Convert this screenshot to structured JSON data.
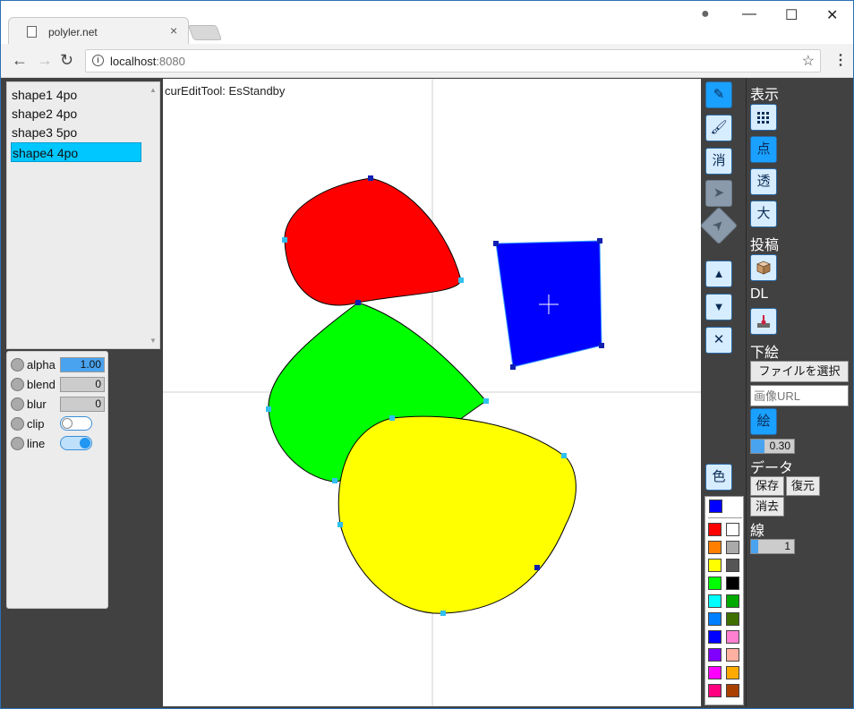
{
  "browser": {
    "tab_title": "polyler.net",
    "tab_close": "×",
    "url_host": "localhost",
    "url_port": ":8080",
    "info_glyph": "i",
    "star": "☆",
    "menu": "⋮",
    "back": "←",
    "forward": "→",
    "reload": "↻",
    "account": "●",
    "minimize": "—",
    "maximize": "☐",
    "close": "✕"
  },
  "shape_list": {
    "items": [
      "shape1 4po",
      "shape2 4po",
      "shape3 5po",
      "shape4 4po"
    ],
    "selected_index": 3,
    "scroll_up": "▲",
    "scroll_down": "▼"
  },
  "props": {
    "alpha": {
      "label": "alpha",
      "value": "1.00"
    },
    "blend": {
      "label": "blend",
      "value": "0"
    },
    "blur": {
      "label": "blur",
      "value": "0"
    },
    "clip": {
      "label": "clip",
      "on": false
    },
    "line": {
      "label": "line",
      "on": true
    }
  },
  "canvas": {
    "status": "curEditTool: EsStandby",
    "shapes": [
      {
        "name": "red",
        "color": "#ff0000"
      },
      {
        "name": "green",
        "color": "#00ff00"
      },
      {
        "name": "yellow",
        "color": "#ffff00"
      },
      {
        "name": "blue",
        "color": "#0000ff"
      }
    ]
  },
  "tools": {
    "pen": "✎",
    "roller": "🖌",
    "erase": "消",
    "select": "➤",
    "direct": "➤",
    "up": "▲",
    "down": "▼",
    "delete": "✕",
    "color": "色"
  },
  "palette": {
    "current": "#0000ff",
    "colors": [
      "#ff0000",
      "#ffffff",
      "#ff7f00",
      "#aaaaaa",
      "#ffff00",
      "#555555",
      "#00ff00",
      "#000000",
      "#00ffff",
      "#00aa00",
      "#0080ff",
      "#3f6f00",
      "#0000ff",
      "#ff80d0",
      "#8000ff",
      "#ffb0a0",
      "#ff00ff",
      "#ffaa00",
      "#ff0080",
      "#aa4000"
    ]
  },
  "right_panel": {
    "display_heading": "表示",
    "grid_icon": "grid-icon",
    "point_btn": "点",
    "transparent_btn": "透",
    "large_btn": "大",
    "post_heading": "投稿",
    "dl_heading": "DL",
    "underpaint_heading": "下絵",
    "file_button": "ファイルを選択",
    "image_url_placeholder": "画像URL",
    "paint_btn": "絵",
    "opacity_value": "0.30",
    "data_heading": "データ",
    "save": "保存",
    "restore": "復元",
    "erase": "消去",
    "line_heading": "線",
    "line_value": "1"
  }
}
